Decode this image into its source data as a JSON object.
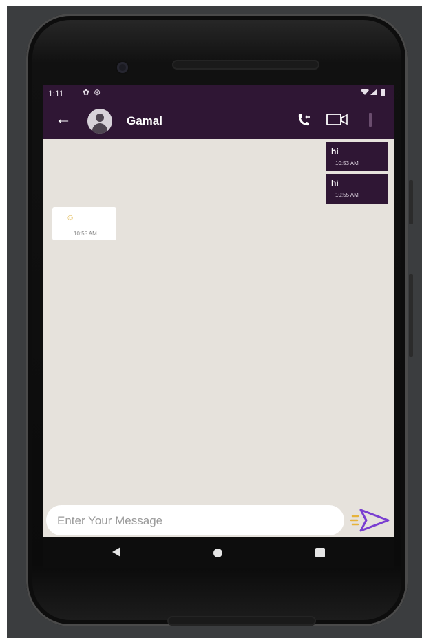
{
  "status_bar": {
    "time": "1:11",
    "left_icons": [
      "gear-icon",
      "data-saver-icon"
    ],
    "right_icons": [
      "wifi-icon",
      "signal-icon",
      "battery-icon"
    ]
  },
  "app_bar": {
    "contact_name": "Gamal",
    "color": "#2f1634"
  },
  "messages": [
    {
      "direction": "outgoing",
      "text": "hi",
      "time": "10:53 AM"
    },
    {
      "direction": "outgoing",
      "text": "hi",
      "time": "10:55 AM"
    },
    {
      "direction": "incoming",
      "text": "",
      "emoji_icon": "emoji-icon",
      "time": "10:55 AM"
    }
  ],
  "composer": {
    "placeholder": "Enter Your Message",
    "send_icon": "send-icon"
  },
  "nav_bar": {
    "icons": [
      "back-triangle-icon",
      "home-circle-icon",
      "recents-square-icon"
    ]
  },
  "colors": {
    "accent": "#2f1634",
    "chat_background": "#e6e2dc",
    "send_icon": "#7a3fd1",
    "send_dashes": "#e6b33a"
  }
}
